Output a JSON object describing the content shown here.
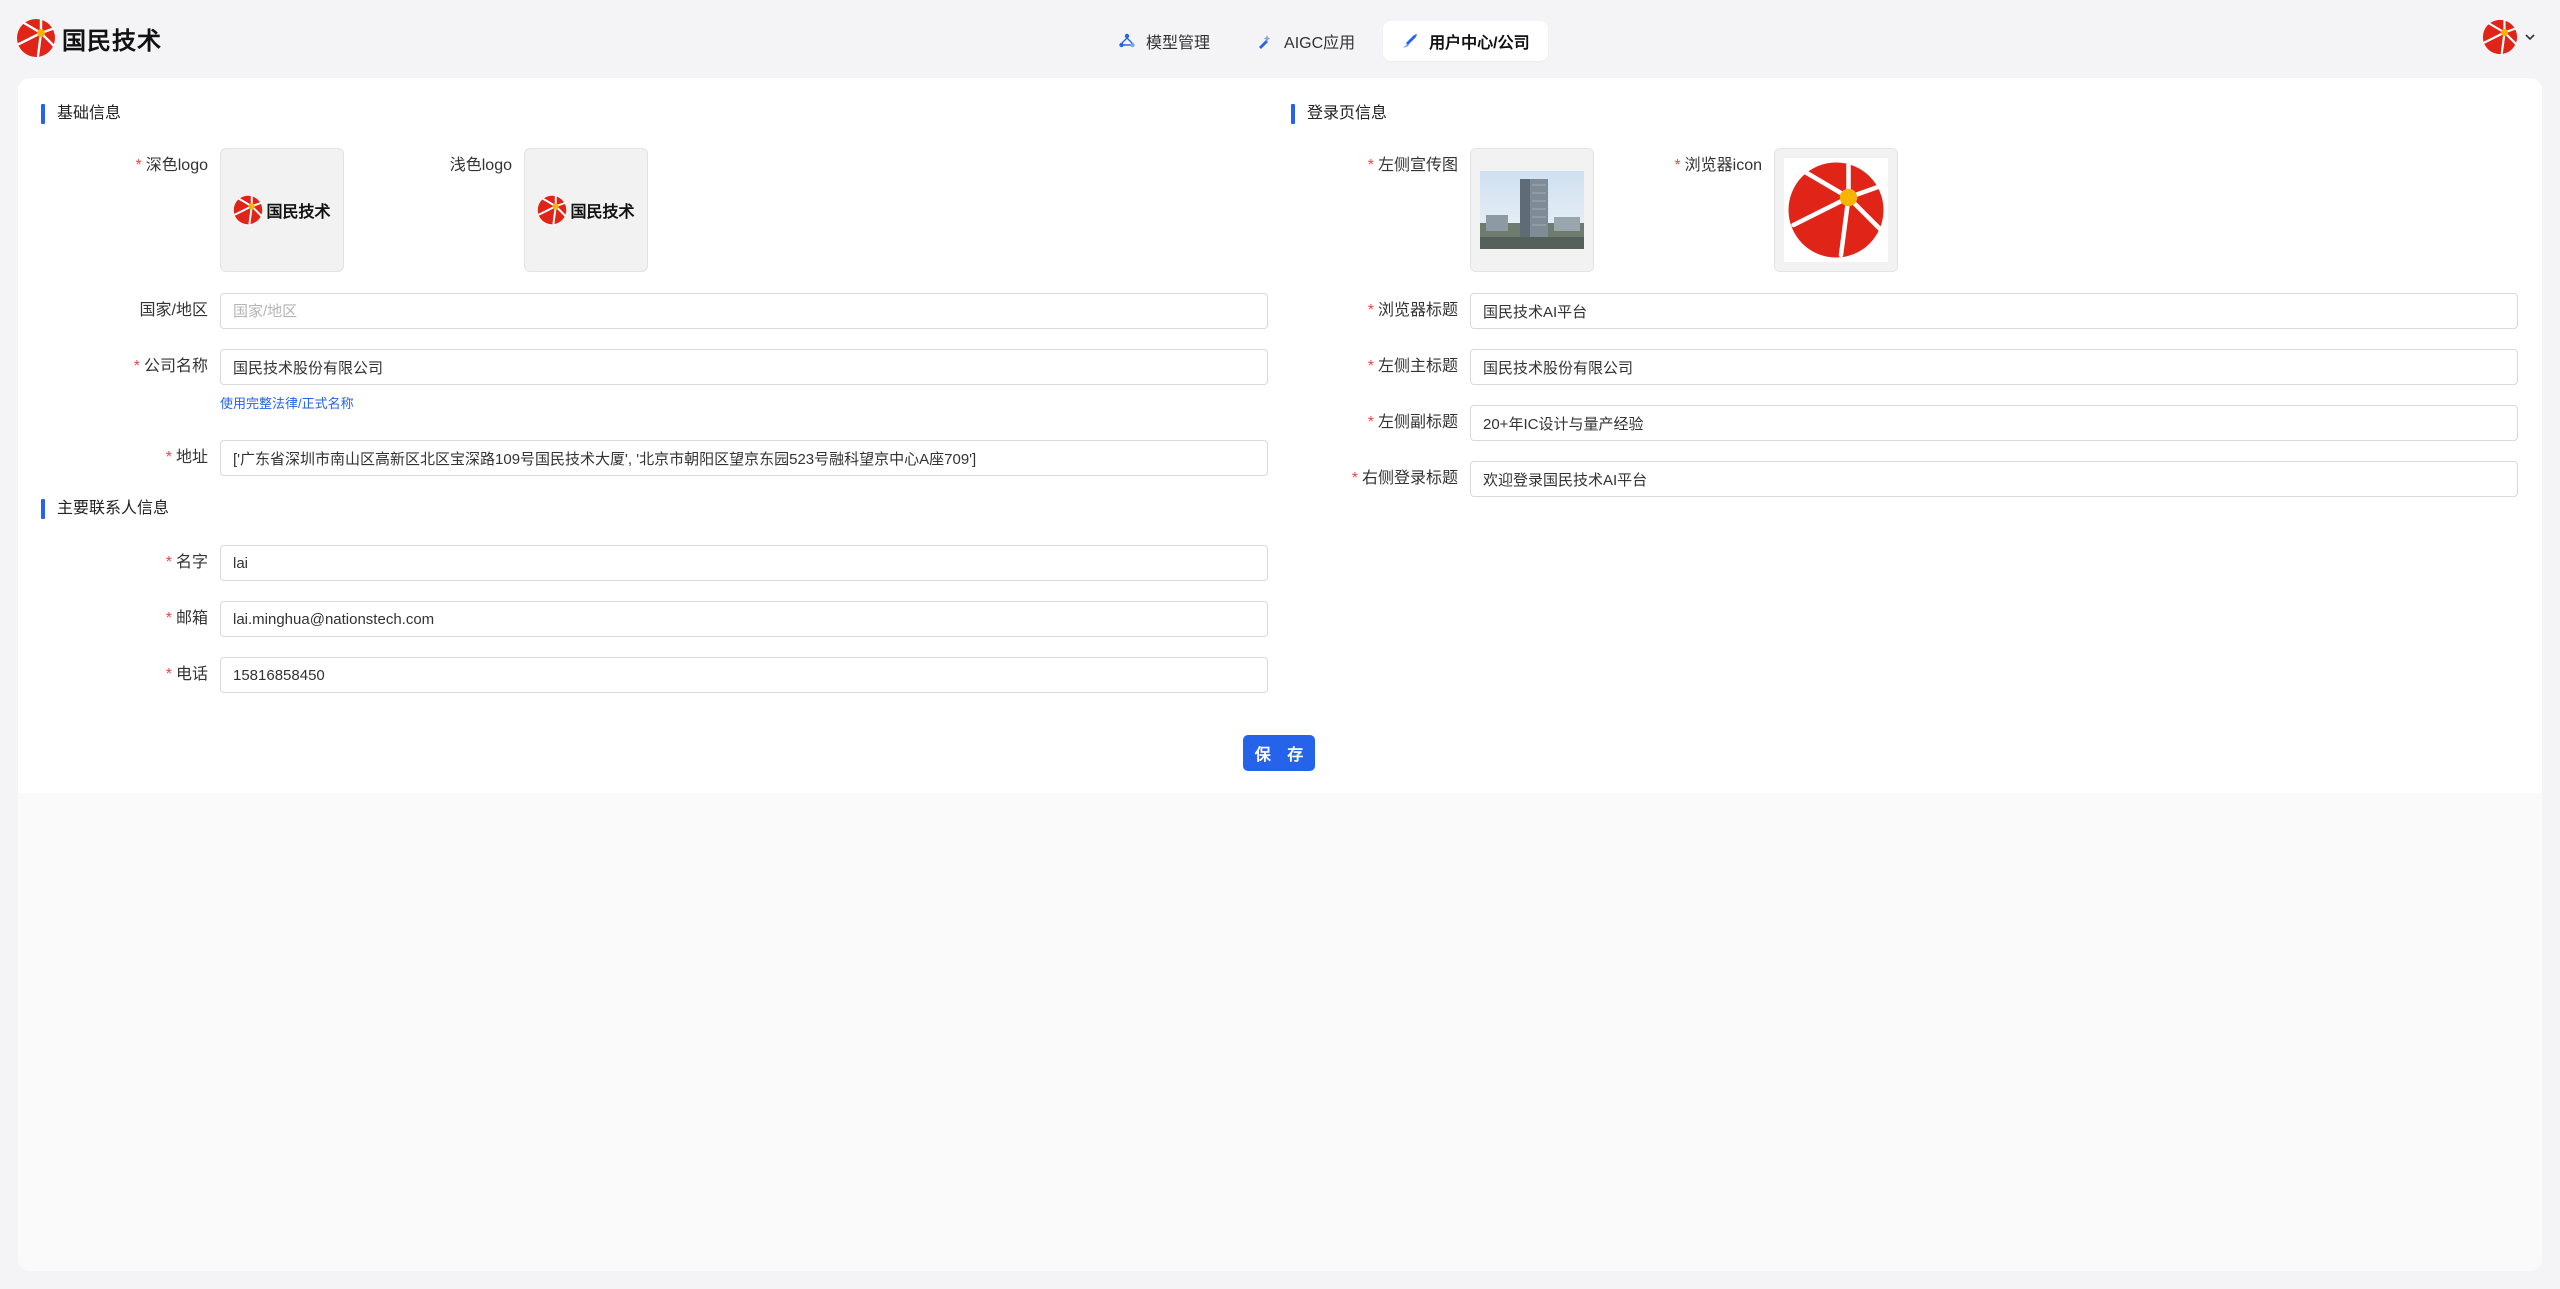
{
  "app": {
    "brand": "国民技术"
  },
  "nav": {
    "tabs": [
      {
        "label": "模型管理",
        "icon": "model-icon"
      },
      {
        "label": "AIGC应用",
        "icon": "aigc-icon"
      },
      {
        "label": "用户中心/公司",
        "icon": "user-center-icon",
        "active": true
      }
    ]
  },
  "colors": {
    "accent": "#2563eb",
    "required": "#e5484d",
    "logo_red": "#e02418",
    "logo_yellow": "#f6b500"
  },
  "basic": {
    "title": "基础信息",
    "dark_logo_label": "深色logo",
    "light_logo_label": "浅色logo",
    "logo_text": "国民技术",
    "country_label": "国家/地区",
    "country_placeholder": "国家/地区",
    "country_value": "",
    "company_label": "公司名称",
    "company_value": "国民技术股份有限公司",
    "company_help": "使用完整法律/正式名称",
    "address_label": "地址",
    "address_value": "['广东省深圳市南山区高新区北区宝深路109号国民技术大厦', '北京市朝阳区望京东园523号融科望京中心A座709']"
  },
  "contact": {
    "title": "主要联系人信息",
    "name_label": "名字",
    "name_value": "lai",
    "email_label": "邮箱",
    "email_value": "lai.minghua@nationstech.com",
    "phone_label": "电话",
    "phone_value": "15816858450"
  },
  "login": {
    "title": "登录页信息",
    "banner_label": "左侧宣传图",
    "icon_label": "浏览器icon",
    "browser_title_label": "浏览器标题",
    "browser_title_value": "国民技术AI平台",
    "left_main_label": "左侧主标题",
    "left_main_value": "国民技术股份有限公司",
    "left_sub_label": "左侧副标题",
    "left_sub_value": "20+年IC设计与量产经验",
    "right_title_label": "右侧登录标题",
    "right_title_value": "欢迎登录国民技术AI平台"
  },
  "actions": {
    "save": "保 存"
  }
}
